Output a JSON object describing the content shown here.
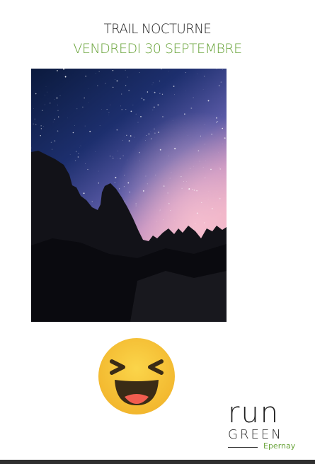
{
  "header": {
    "title": "TRAIL NOCTURNE",
    "subtitle": "VENDREDI 30 SEPTEMBRE"
  },
  "logo": {
    "word_top": "run",
    "word_bottom": "GREEN",
    "place": "Epernay"
  },
  "colors": {
    "brand_green": "#6aa43b",
    "text_dark": "#1a1a1a",
    "emoji_yellow": "#f7c53b"
  },
  "icons": {
    "emoji": "laughing-face-icon"
  }
}
